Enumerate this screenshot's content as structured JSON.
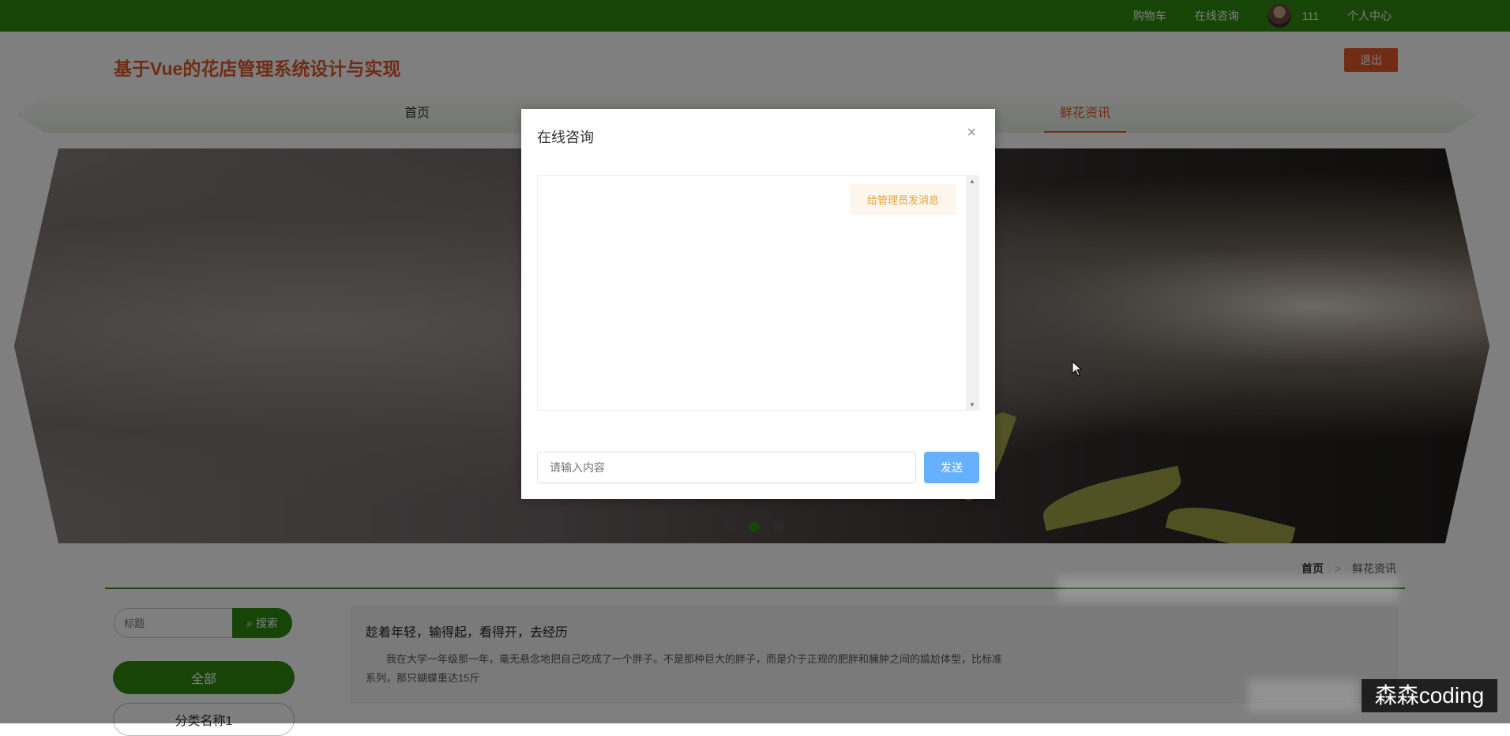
{
  "topbar": {
    "cart": "购物车",
    "online_consult": "在线咨询",
    "username": "111",
    "personal_center": "个人中心"
  },
  "header": {
    "title": "基于Vue的花店管理系统设计与实现",
    "logout": "退出"
  },
  "nav": {
    "items": [
      {
        "label": "首页"
      },
      {
        "label": "鲜花资讯"
      }
    ]
  },
  "breadcrumb": {
    "home": "首页",
    "separator": ">",
    "current": "鲜花资讯"
  },
  "sidebar": {
    "search_placeholder": "标题",
    "search_button": "搜索",
    "categories": [
      "全部",
      "分类名称1"
    ]
  },
  "article": {
    "title": "趁着年轻，输得起，看得开，去经历",
    "excerpt": "我在大学一年级那一年，毫无悬念地把自己吃成了一个胖子。不是那种巨大的胖子，而是介于正规的肥胖和臃肿之间的尴尬体型，比标准",
    "excerpt_2": "系列，那只蝴蝶重达15斤"
  },
  "modal": {
    "title": "在线咨询",
    "close": "×",
    "message": "给管理员发消息",
    "input_placeholder": "请输入内容",
    "send": "发送"
  },
  "watermark": "森森coding",
  "colors": {
    "brand_green": "#2d8a0f",
    "accent_orange": "#e0592b",
    "send_blue": "#66b1ff"
  }
}
